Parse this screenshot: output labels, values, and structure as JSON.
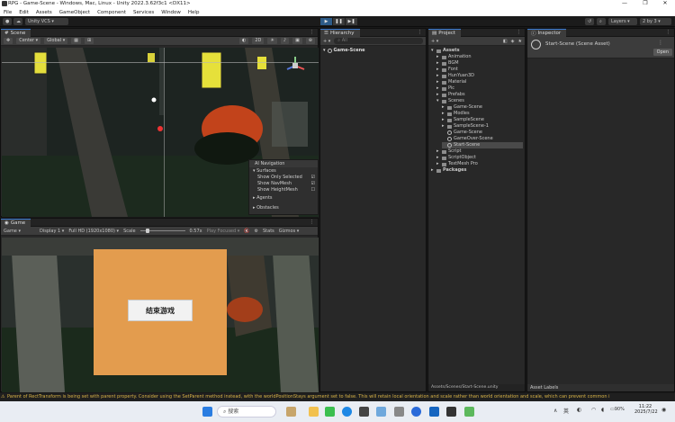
{
  "window": {
    "title": "RPG - Game-Scene - Windows, Mac, Linux - Unity 2022.3.62f3c1 <DX11>"
  },
  "menu": [
    "File",
    "Edit",
    "Assets",
    "GameObject",
    "Component",
    "Services",
    "Window",
    "Help"
  ],
  "toolbar": {
    "vcs_label": "Unity VCS",
    "layers_label": "Layers",
    "layout_label": "2 by 3"
  },
  "scene_panel": {
    "tab_label": "Scene",
    "center_label": "Center",
    "global_label": "Global",
    "ai_nav": {
      "title": "AI Navigation",
      "surfaces_label": "Surfaces",
      "options": [
        {
          "label": "Show Only Selected",
          "checked": true
        },
        {
          "label": "Show NavMesh",
          "checked": true
        },
        {
          "label": "Show HeightMesh",
          "checked": false
        }
      ],
      "agents_label": "Agents",
      "obstacles_label": "Obstacles"
    }
  },
  "game_panel": {
    "tab_label": "Game",
    "mode_label": "Game",
    "display_label": "Display 1",
    "resolution_label": "Full HD (1920x1080)",
    "scale_label": "Scale",
    "scale_value": "0.57x",
    "play_focused_label": "Play Focused",
    "stats_label": "Stats",
    "gizmos_label": "Gizmos",
    "dialog_button_label": "结束游戏"
  },
  "hierarchy": {
    "tab_label": "Hierarchy",
    "search_placeholder": "All",
    "root_label": "Game-Scene"
  },
  "project": {
    "tab_label": "Project",
    "items": [
      {
        "label": "Assets",
        "depth": 0,
        "type": "folder-open",
        "bold": true
      },
      {
        "label": "Animation",
        "depth": 1,
        "type": "folder"
      },
      {
        "label": "BGM",
        "depth": 1,
        "type": "folder"
      },
      {
        "label": "Font",
        "depth": 1,
        "type": "folder"
      },
      {
        "label": "HunYuan3D",
        "depth": 1,
        "type": "folder"
      },
      {
        "label": "Material",
        "depth": 1,
        "type": "folder"
      },
      {
        "label": "Pic",
        "depth": 1,
        "type": "folder"
      },
      {
        "label": "Prefabs",
        "depth": 1,
        "type": "folder"
      },
      {
        "label": "Scenes",
        "depth": 1,
        "type": "folder-open"
      },
      {
        "label": "Game-Scene",
        "depth": 2,
        "type": "folder"
      },
      {
        "label": "Modles",
        "depth": 2,
        "type": "folder"
      },
      {
        "label": "SampleScene",
        "depth": 2,
        "type": "folder"
      },
      {
        "label": "SampleScene-1",
        "depth": 2,
        "type": "folder"
      },
      {
        "label": "Game-Scene",
        "depth": 2,
        "type": "scene"
      },
      {
        "label": "GameOver-Scene",
        "depth": 2,
        "type": "scene"
      },
      {
        "label": "Start-Scene",
        "depth": 2,
        "type": "scene",
        "selected": true
      },
      {
        "label": "Script",
        "depth": 1,
        "type": "folder"
      },
      {
        "label": "ScriptObject",
        "depth": 1,
        "type": "folder"
      },
      {
        "label": "TextMesh Pro",
        "depth": 1,
        "type": "folder"
      },
      {
        "label": "Packages",
        "depth": 0,
        "type": "folder",
        "bold": true
      }
    ],
    "footer_path": "Assets/Scenes/Start-Scene.unity"
  },
  "inspector": {
    "tab_label": "Inspector",
    "asset_title": "Start-Scene (Scene Asset)",
    "open_button_label": "Open",
    "asset_labels_label": "Asset Labels"
  },
  "status_bar": {
    "message": "Parent of RectTransform is being set with parent property. Consider using the SetParent method instead, with the worldPositionStays argument set to false. This will retain local orientation and scale rather than world orientation and scale, which can prevent common i"
  },
  "taskbar": {
    "search_placeholder": "搜索",
    "ime_label": "英",
    "battery_label": "90%",
    "time": "11:22",
    "date": "2025/7/22"
  },
  "colors": {
    "accent": "#3b7ad1",
    "dialog": "#e39c4e",
    "warning": "#d9b447"
  }
}
